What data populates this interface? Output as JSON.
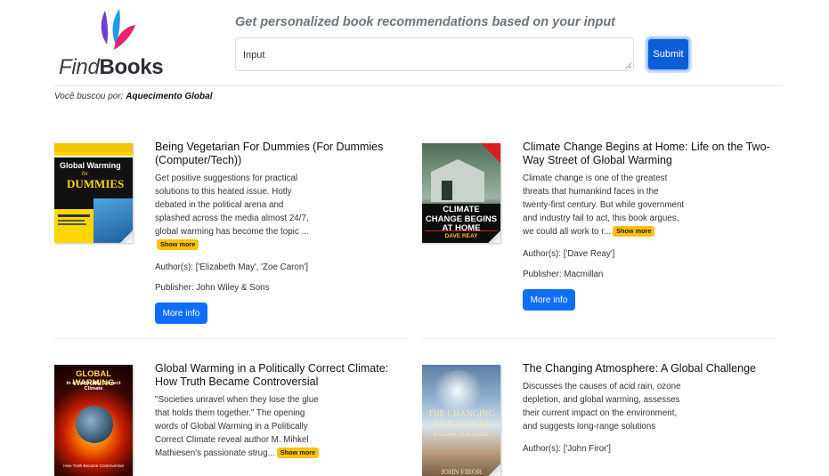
{
  "header": {
    "logo_find": "Find",
    "logo_books": "Books",
    "tagline": "Get personalized book recommendations based on your input",
    "input_value": "Input",
    "submit_label": "Submit"
  },
  "search_summary": {
    "prefix": "Você buscou por:",
    "query": "Aquecimento Global"
  },
  "labels": {
    "show_more": "Show more",
    "more_info": "More info"
  },
  "books": [
    {
      "title": "Being Vegetarian For Dummies (For Dummies (Computer/Tech))",
      "description": "Get positive suggestions for practical solutions to this heated issue. Hotly debated in the political arena and splashed across the media almost 24/7, global warming has become the topic ...",
      "authors": "Author(s): ['Elizabeth May', 'Zoe Caron']",
      "publisher": "Publisher: John Wiley & Sons",
      "cover": {
        "top_text": "Global Warming",
        "sub_text": "DUMMIES",
        "small": "for"
      }
    },
    {
      "title": "Climate Change Begins at Home: Life on the Two-Way Street of Global Warming",
      "description": "Climate change is one of the greatest threats that humankind faces in the twenty-first century. But while government and industry fail to act, this book argues, we could all work to r...",
      "authors": "Author(s): ['Dave Reay']",
      "publisher": "Publisher: Macmillan",
      "cover": {
        "top_text": "CLIMATE CHANGE BEGINS AT HOME",
        "sub_text": "DAVE REAY"
      }
    },
    {
      "title": "Global Warming in a Politically Correct Climate: How Truth Became Controversial",
      "description": "\"Societies unravel when they lose the glue that holds them together.\" The opening words of Global Warming in a Politically Correct Climate reveal author M. Mihkel Mathiesen's passionate strug...",
      "cover": {
        "top_text": "GLOBAL WARMING",
        "sub_text": "in a Politically Correct Climate",
        "small": "How Truth Became Controversial"
      }
    },
    {
      "title": "The Changing Atmosphere: A Global Challenge",
      "description": "Discusses the causes of acid rain, ozone depletion, and global warming, assesses their current impact on the environment, and suggests long-range solutions",
      "authors": "Author(s): ['John Firor']",
      "cover": {
        "top_text": "THE CHANGING ATMOSPHERE",
        "sub_text": "A GLOBAL CHALLENGE",
        "small": "JOHN FIROR"
      }
    }
  ]
}
